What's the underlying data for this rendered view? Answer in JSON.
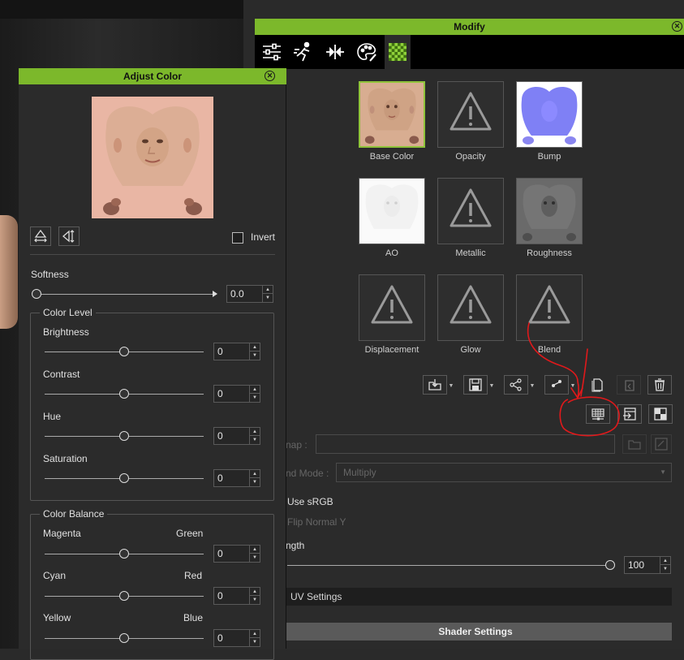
{
  "modify": {
    "title": "Modify",
    "tabs": [
      {
        "icon": "sliders-icon"
      },
      {
        "icon": "motion-icon"
      },
      {
        "icon": "align-icon"
      },
      {
        "icon": "palette-icon"
      },
      {
        "icon": "checker-icon"
      }
    ],
    "channels": [
      {
        "label": "Base Color",
        "kind": "face-texture"
      },
      {
        "label": "Opacity",
        "kind": "warning"
      },
      {
        "label": "Bump",
        "kind": "normal-texture"
      },
      {
        "label": "AO",
        "kind": "ao-texture"
      },
      {
        "label": "Metallic",
        "kind": "warning"
      },
      {
        "label": "Roughness",
        "kind": "rough-texture"
      },
      {
        "label": "Displacement",
        "kind": "warning"
      },
      {
        "label": "Glow",
        "kind": "warning"
      },
      {
        "label": "Blend",
        "kind": "warning"
      }
    ],
    "map_label": "nap :",
    "blend_mode_label": "nd Mode :",
    "blend_mode_value": "Multiply",
    "use_srgb_label": "Use sRGB",
    "flip_normal_label": "Flip Normal Y",
    "strength_label": "ngth",
    "strength_value": "100",
    "strength_level": 1.0,
    "uv_settings_label": "UV Settings",
    "shader_settings_label": "Shader Settings"
  },
  "adjust_color": {
    "title": "Adjust Color",
    "invert_label": "Invert",
    "softness_label": "Softness",
    "softness_value": "0.0",
    "color_level_title": "Color Level",
    "brightness_label": "Brightness",
    "brightness_value": "0",
    "contrast_label": "Contrast",
    "contrast_value": "0",
    "hue_label": "Hue",
    "hue_value": "0",
    "saturation_label": "Saturation",
    "saturation_value": "0",
    "color_balance_title": "Color Balance",
    "magenta_label": "Magenta",
    "green_label": "Green",
    "magenta_green_value": "0",
    "cyan_label": "Cyan",
    "red_label": "Red",
    "cyan_red_value": "0",
    "yellow_label": "Yellow",
    "blue_label": "Blue",
    "yellow_blue_value": "0"
  },
  "colors": {
    "title_bar": "#7cb82b",
    "annotation": "#e0191b"
  }
}
